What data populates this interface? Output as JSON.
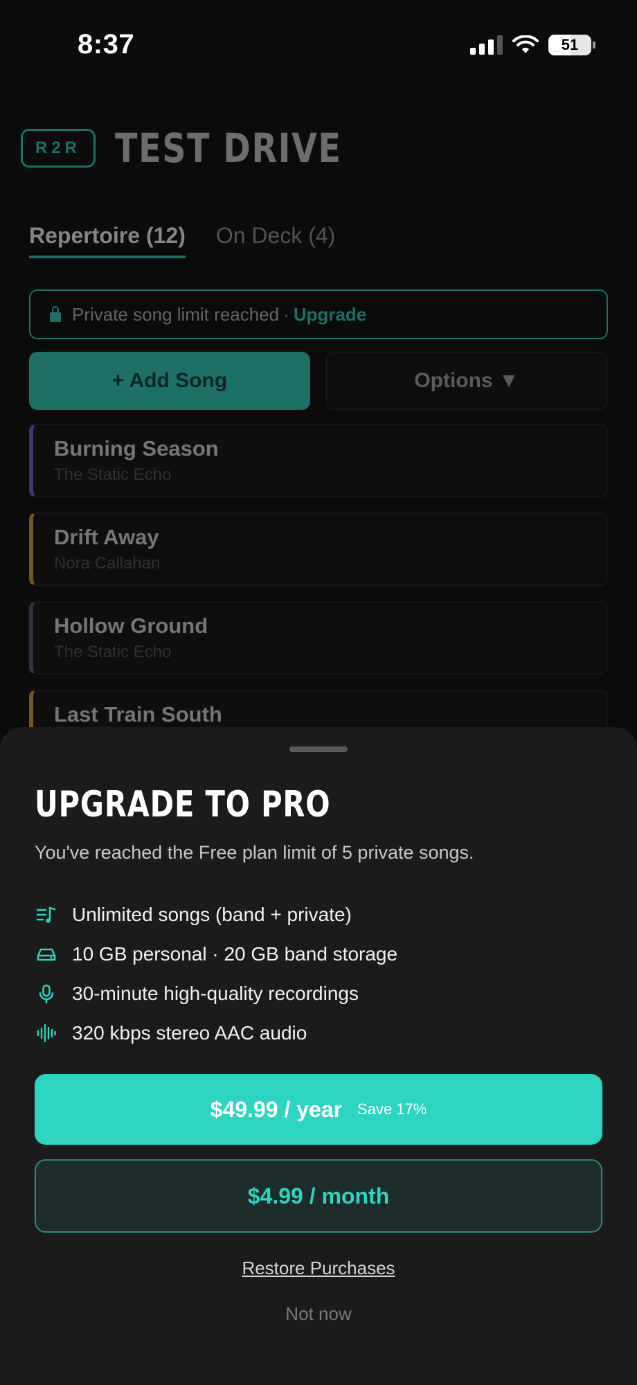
{
  "status_bar": {
    "time": "8:37",
    "battery": "51"
  },
  "app": {
    "badge": "R2R",
    "title": "TEST DRIVE",
    "tabs": [
      {
        "label": "Repertoire (12)",
        "active": true
      },
      {
        "label": "On Deck (4)",
        "active": false
      }
    ],
    "notice": {
      "text": "Private song limit reached",
      "separator": "·",
      "link": "Upgrade"
    },
    "add_button": "+ Add Song",
    "options_button": "Options ▼",
    "songs": [
      {
        "title": "Burning Season",
        "artist": "The Static Echo",
        "accent": "#7c5cd6"
      },
      {
        "title": "Drift Away",
        "artist": "Nora Callahan",
        "accent": "#e0a13a"
      },
      {
        "title": "Hollow Ground",
        "artist": "The Static Echo",
        "accent": "#5a5a7a"
      },
      {
        "title": "Last Train South",
        "artist": "",
        "accent": "#e0a13a"
      }
    ]
  },
  "sheet": {
    "title": "UPGRADE TO PRO",
    "subtitle": "You've reached the Free plan limit of 5 private songs.",
    "features": [
      {
        "icon": "music-list-icon",
        "text": "Unlimited songs (band + private)"
      },
      {
        "icon": "hard-drive-icon",
        "text": "10 GB personal · 20 GB band storage"
      },
      {
        "icon": "microphone-icon",
        "text": "30-minute high-quality recordings"
      },
      {
        "icon": "waveform-icon",
        "text": "320 kbps stereo AAC audio"
      }
    ],
    "yearly": {
      "price": "$49.99 / year",
      "save": "Save 17%"
    },
    "monthly": {
      "price": "$4.99 / month"
    },
    "restore": "Restore Purchases",
    "not_now": "Not now"
  },
  "colors": {
    "accent": "#2dd4bf",
    "sheet_bg": "#1b1b1b",
    "page_bg": "#0b0b0b"
  }
}
